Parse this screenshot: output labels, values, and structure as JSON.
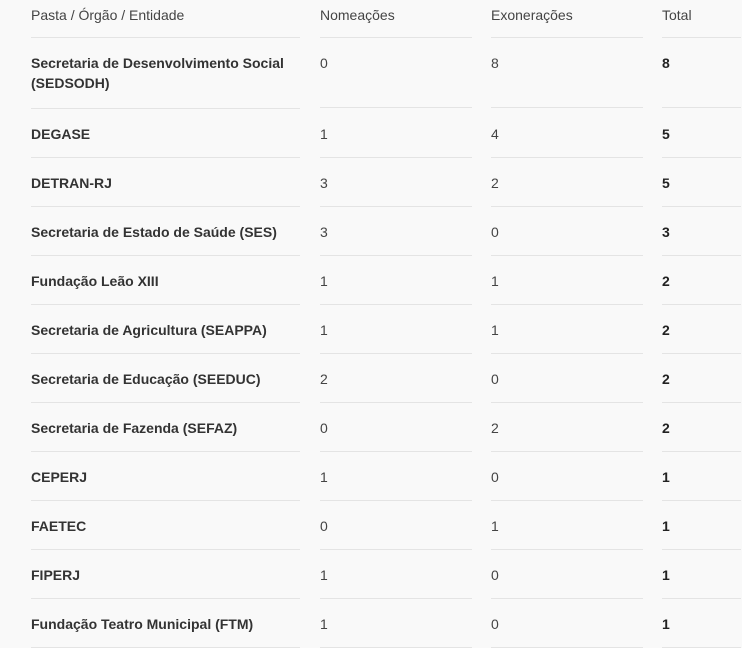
{
  "table": {
    "headers": [
      "Pasta / Órgão / Entidade",
      "Nomeações",
      "Exonerações",
      "Total"
    ],
    "rows": [
      {
        "entity": "Secretaria de Desenvolvimento Social (SEDSODH)",
        "nomeacoes": "0",
        "exoneracoes": "8",
        "total": "8"
      },
      {
        "entity": "DEGASE",
        "nomeacoes": "1",
        "exoneracoes": "4",
        "total": "5"
      },
      {
        "entity": "DETRAN-RJ",
        "nomeacoes": "3",
        "exoneracoes": "2",
        "total": "5"
      },
      {
        "entity": "Secretaria de Estado de Saúde (SES)",
        "nomeacoes": "3",
        "exoneracoes": "0",
        "total": "3"
      },
      {
        "entity": "Fundação Leão XIII",
        "nomeacoes": "1",
        "exoneracoes": "1",
        "total": "2"
      },
      {
        "entity": "Secretaria de Agricultura (SEAPPA)",
        "nomeacoes": "1",
        "exoneracoes": "1",
        "total": "2"
      },
      {
        "entity": "Secretaria de Educação (SEEDUC)",
        "nomeacoes": "2",
        "exoneracoes": "0",
        "total": "2"
      },
      {
        "entity": "Secretaria de Fazenda (SEFAZ)",
        "nomeacoes": "0",
        "exoneracoes": "2",
        "total": "2"
      },
      {
        "entity": "CEPERJ",
        "nomeacoes": "1",
        "exoneracoes": "0",
        "total": "1"
      },
      {
        "entity": "FAETEC",
        "nomeacoes": "0",
        "exoneracoes": "1",
        "total": "1"
      },
      {
        "entity": "FIPERJ",
        "nomeacoes": "1",
        "exoneracoes": "0",
        "total": "1"
      },
      {
        "entity": "Fundação Teatro Municipal (FTM)",
        "nomeacoes": "1",
        "exoneracoes": "0",
        "total": "1"
      }
    ]
  }
}
